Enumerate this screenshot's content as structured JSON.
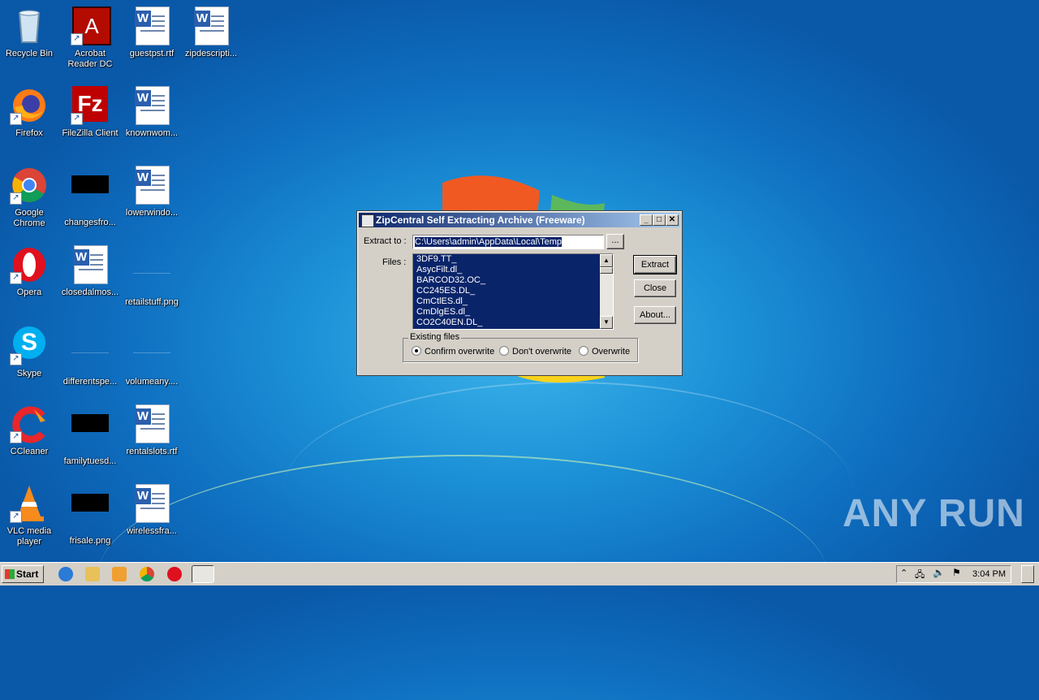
{
  "desktop": {
    "icons": [
      {
        "label": "Recycle Bin",
        "icon": "recycle-bin-icon"
      },
      {
        "label": "Acrobat\nReader DC",
        "icon": "acrobat-icon"
      },
      {
        "label": "guestpst.rtf",
        "icon": "word-doc-icon"
      },
      {
        "label": "zipdescripti...",
        "icon": "word-doc-icon"
      },
      {
        "label": "Firefox",
        "icon": "firefox-icon"
      },
      {
        "label": "FileZilla Client",
        "icon": "filezilla-icon"
      },
      {
        "label": "knownwom...",
        "icon": "word-doc-icon"
      },
      {
        "label": "Google\nChrome",
        "icon": "chrome-icon"
      },
      {
        "label": "changesfro...",
        "icon": "black-image-icon"
      },
      {
        "label": "lowerwindo...",
        "icon": "word-doc-icon"
      },
      {
        "label": "Opera",
        "icon": "opera-icon"
      },
      {
        "label": "closedalmos...",
        "icon": "word-doc-icon"
      },
      {
        "label": "retailstuff.png",
        "icon": "image-file-icon"
      },
      {
        "label": "Skype",
        "icon": "skype-icon"
      },
      {
        "label": "differentspe...",
        "icon": "image-file-icon"
      },
      {
        "label": "volumeany....",
        "icon": "image-file-icon"
      },
      {
        "label": "CCleaner",
        "icon": "ccleaner-icon"
      },
      {
        "label": "familytuesd...",
        "icon": "black-image-icon"
      },
      {
        "label": "rentalslots.rtf",
        "icon": "word-doc-icon"
      },
      {
        "label": "VLC media\nplayer",
        "icon": "vlc-icon"
      },
      {
        "label": "frisale.png",
        "icon": "black-image-icon"
      },
      {
        "label": "wirelessfra...",
        "icon": "word-doc-icon"
      }
    ]
  },
  "dialog": {
    "title": "ZipCentral Self Extracting Archive (Freeware)",
    "extract_to_label": "Extract to :",
    "extract_path": "C:\\Users\\admin\\AppData\\Local\\Temp",
    "browse_label": "...",
    "files_label": "Files :",
    "files": [
      "3DF9.TT_",
      "AsycFilt.dl_",
      "BARCOD32.OC_",
      "CC245ES.DL_",
      "CmCtlES.dl_",
      "CmDlgES.dl_",
      "CO2C40EN.DL_"
    ],
    "extract_button": "Extract",
    "close_button": "Close",
    "about_button": "About...",
    "existing_files_label": "Existing files",
    "options": [
      {
        "label": "Confirm overwrite",
        "selected": true
      },
      {
        "label": "Don't overwrite",
        "selected": false
      },
      {
        "label": "Overwrite",
        "selected": false
      }
    ]
  },
  "taskbar": {
    "start_label": "Start",
    "clock": "3:04 PM"
  },
  "watermark": "ANY RUN"
}
